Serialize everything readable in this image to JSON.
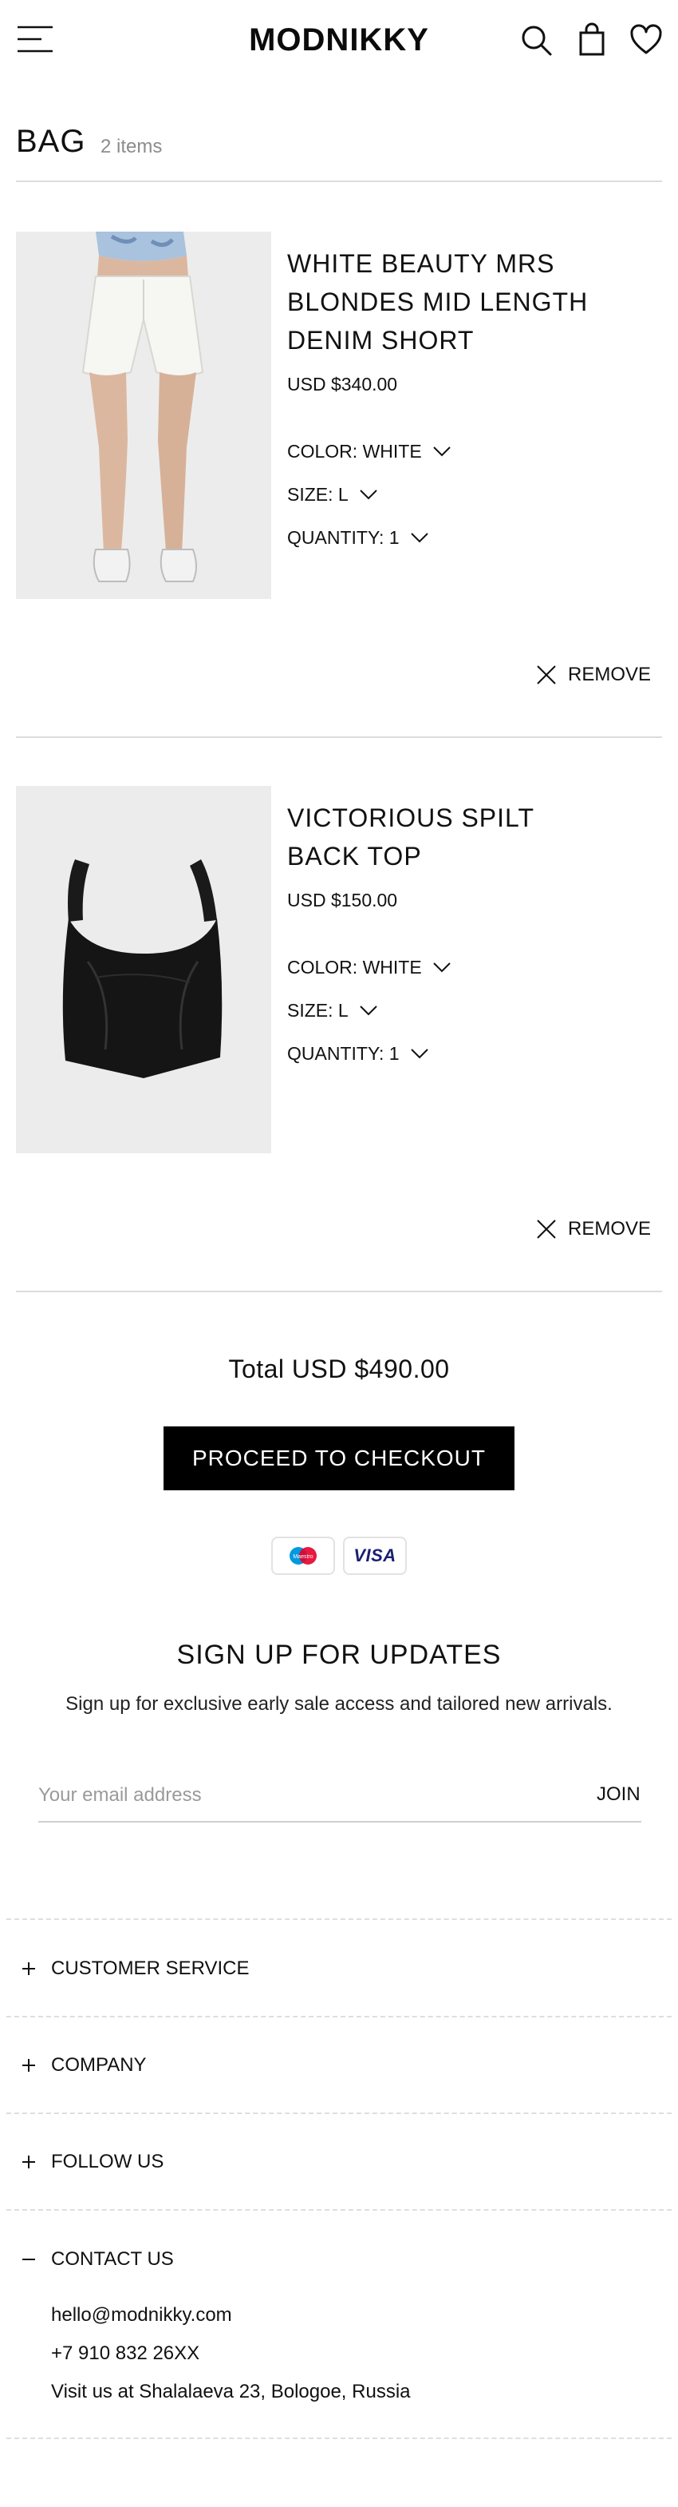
{
  "header": {
    "brand": "MODNIKKY",
    "menu_icon": "hamburger-menu-icon",
    "search_icon": "search-icon",
    "bag_icon": "shopping-bag-icon",
    "wishlist_icon": "heart-icon"
  },
  "bag": {
    "title": "BAG",
    "count": "2 items"
  },
  "items": [
    {
      "title_line1": "WHITE BEAUTY MRS",
      "title_line2": "BLONDES MID LENGTH",
      "title_line3": "DENIM SHORT",
      "price": "USD $340.00",
      "color": "COLOR: WHITE",
      "size": "SIZE: L",
      "quantity": "QUANTITY: 1",
      "remove": "REMOVE"
    },
    {
      "title_line1": "VICTORIOUS SPILT",
      "title_line2": "BACK TOP",
      "price": "USD $150.00",
      "color": "COLOR: WHITE",
      "size": "SIZE: L",
      "quantity": "QUANTITY: 1",
      "remove": "REMOVE"
    }
  ],
  "summary": {
    "total": "Total USD $490.00",
    "checkout": "PROCEED TO CHECKOUT",
    "payment_methods": {
      "maestro": "Maestro",
      "visa": "VISA"
    }
  },
  "newsletter": {
    "title": "SIGN UP FOR UPDATES",
    "subtitle": "Sign up for exclusive early sale access and tailored new arrivals.",
    "placeholder": "Your email address",
    "join": "JOIN"
  },
  "footer": {
    "sections": [
      "CUSTOMER SERVICE",
      "COMPANY",
      "FOLLOW US",
      "CONTACT US"
    ],
    "contact": {
      "email": "hello@modnikky.com",
      "phone": "+7 910 832 26XX",
      "address": "Visit us at Shalalaeva 23, Bologoe, Russia"
    }
  },
  "colors": {
    "accent": "#000000",
    "divider": "#dcdcdc",
    "muted_text": "#8c8c8c",
    "maestro_red": "#e4002b",
    "maestro_blue": "#0099df",
    "visa_blue": "#1a1f71"
  }
}
